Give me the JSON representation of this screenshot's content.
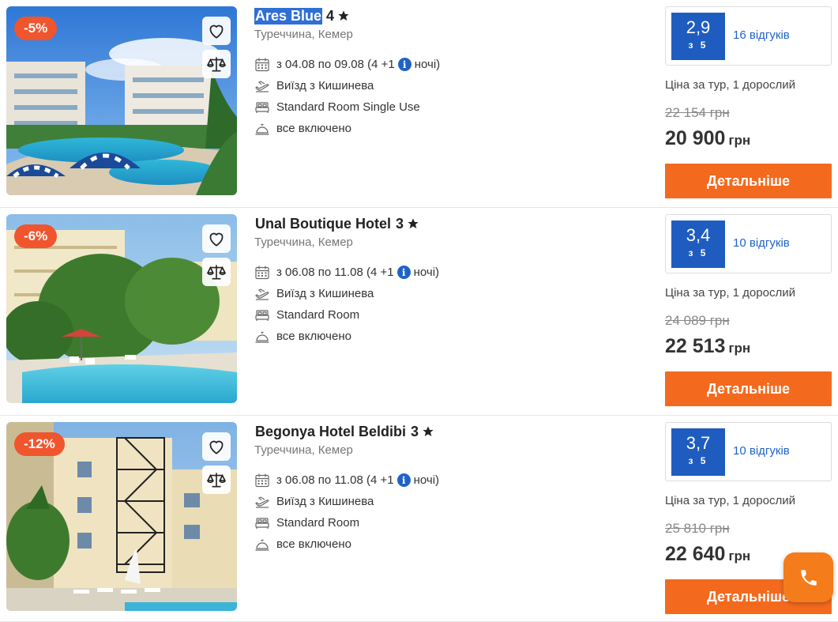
{
  "hotels": [
    {
      "name": "Ares Blue",
      "stars": "4",
      "location": "Туреччина, Кемер",
      "discount": "-5%",
      "dates": "з 04.08 по 09.08 (4 +1",
      "nights_label": "ночі)",
      "departure": "Виїзд з Кишинева",
      "room": "Standard Room Single Use",
      "board": "все включено",
      "rating": "2,9",
      "rating_max": "з 5",
      "reviews": "16 відгуків",
      "price_label": "Ціна за тур, 1 дорослий",
      "old_price": "22 154 грн",
      "price": "20 900",
      "currency": "грн",
      "button": "Детальніше"
    },
    {
      "name": "Unal Boutique Hotel",
      "stars": "3",
      "location": "Туреччина, Кемер",
      "discount": "-6%",
      "dates": "з 06.08 по 11.08 (4 +1",
      "nights_label": "ночі)",
      "departure": "Виїзд з Кишинева",
      "room": "Standard Room",
      "board": "все включено",
      "rating": "3,4",
      "rating_max": "з 5",
      "reviews": "10 відгуків",
      "price_label": "Ціна за тур, 1 дорослий",
      "old_price": "24 089 грн",
      "price": "22 513",
      "currency": "грн",
      "button": "Детальніше"
    },
    {
      "name": "Begonya Hotel Beldibi",
      "stars": "3",
      "location": "Туреччина, Кемер",
      "discount": "-12%",
      "dates": "з 06.08 по 11.08 (4 +1",
      "nights_label": "ночі)",
      "departure": "Виїзд з Кишинева",
      "room": "Standard Room",
      "board": "все включено",
      "rating": "3,7",
      "rating_max": "з 5",
      "reviews": "10 відгуків",
      "price_label": "Ціна за тур, 1 дорослий",
      "old_price": "25 810 грн",
      "price": "22 640",
      "currency": "грн",
      "button": "Детальніше"
    }
  ],
  "colors": {
    "accent": "#f36a1f",
    "rating_blue": "#1f5cc0",
    "discount_red": "#f0552d",
    "link_blue": "#1f63c6"
  },
  "icons": {
    "favorite": "heart-icon",
    "compare": "scales-icon",
    "calendar": "calendar-icon",
    "departure": "plane-takeoff-icon",
    "room": "bed-icon",
    "board": "room-service-icon",
    "call": "phone-icon"
  }
}
